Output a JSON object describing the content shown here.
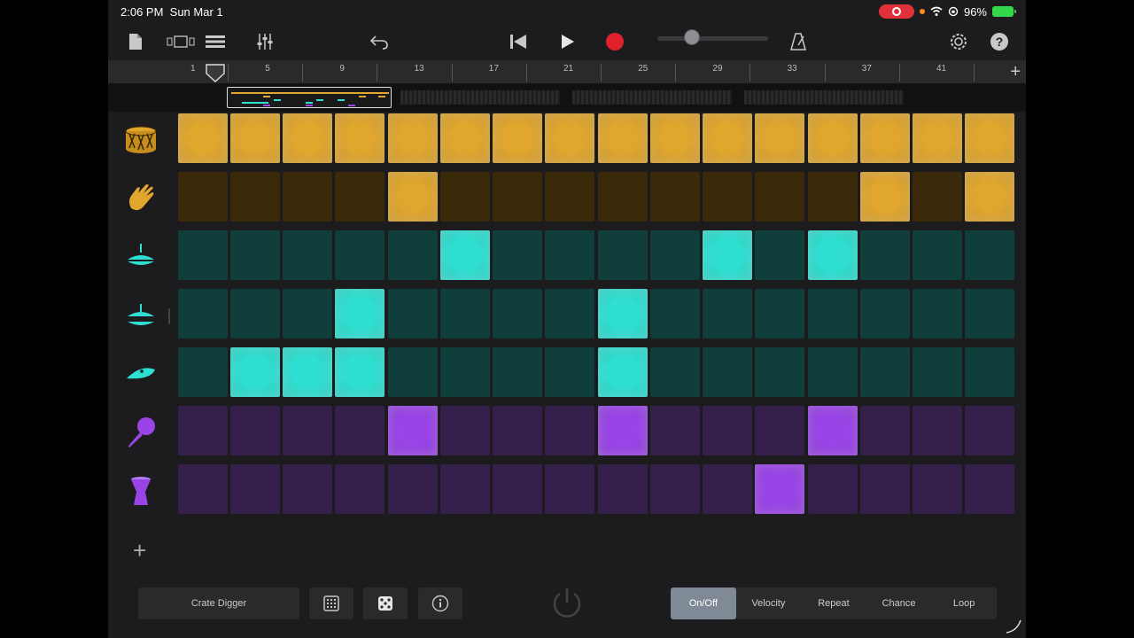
{
  "status": {
    "time": "2:06 PM",
    "date": "Sun Mar 1",
    "battery": "96%"
  },
  "ruler": {
    "bars": [
      "1",
      "5",
      "9",
      "13",
      "17",
      "21",
      "25",
      "29",
      "33",
      "37",
      "41"
    ]
  },
  "colors": {
    "gold_on": "#e0a62e",
    "gold_off": "#3a2a0a",
    "teal_on": "#2fe0d2",
    "teal_off": "#0f3e3b",
    "purple_on": "#9a44e8",
    "purple_off": "#351f4b",
    "accent_record": "#e0202a"
  },
  "tracks": [
    {
      "name": "snare-drum",
      "icon": "snare-drum-icon",
      "color": "gold",
      "steps": [
        1,
        1,
        1,
        1,
        1,
        1,
        1,
        1,
        1,
        1,
        1,
        1,
        1,
        1,
        1,
        1
      ]
    },
    {
      "name": "clap",
      "icon": "clap-icon",
      "color": "gold",
      "steps": [
        0,
        0,
        0,
        0,
        1,
        0,
        0,
        0,
        0,
        0,
        0,
        0,
        0,
        1,
        0,
        1
      ]
    },
    {
      "name": "hihat-closed",
      "icon": "hihat-closed-icon",
      "color": "teal",
      "steps": [
        0,
        0,
        0,
        0,
        0,
        1,
        0,
        0,
        0,
        0,
        1,
        0,
        1,
        0,
        0,
        0
      ]
    },
    {
      "name": "hihat-open",
      "icon": "hihat-open-icon",
      "color": "teal",
      "steps": [
        0,
        0,
        0,
        1,
        0,
        0,
        0,
        0,
        1,
        0,
        0,
        0,
        0,
        0,
        0,
        0
      ]
    },
    {
      "name": "cymbal",
      "icon": "cymbal-icon",
      "color": "teal",
      "steps": [
        0,
        1,
        1,
        1,
        0,
        0,
        0,
        0,
        1,
        0,
        0,
        0,
        0,
        0,
        0,
        0
      ]
    },
    {
      "name": "maraca",
      "icon": "maraca-icon",
      "color": "purple",
      "steps": [
        0,
        0,
        0,
        0,
        1,
        0,
        0,
        0,
        1,
        0,
        0,
        0,
        1,
        0,
        0,
        0
      ]
    },
    {
      "name": "djembe",
      "icon": "djembe-icon",
      "color": "purple",
      "steps": [
        0,
        0,
        0,
        0,
        0,
        0,
        0,
        0,
        0,
        0,
        0,
        1,
        0,
        0,
        0,
        0
      ]
    }
  ],
  "bottom": {
    "kit_name": "Crate Digger",
    "modes": [
      {
        "label": "On/Off",
        "active": true
      },
      {
        "label": "Velocity",
        "active": false
      },
      {
        "label": "Repeat",
        "active": false
      },
      {
        "label": "Chance",
        "active": false
      },
      {
        "label": "Loop",
        "active": false
      }
    ]
  }
}
